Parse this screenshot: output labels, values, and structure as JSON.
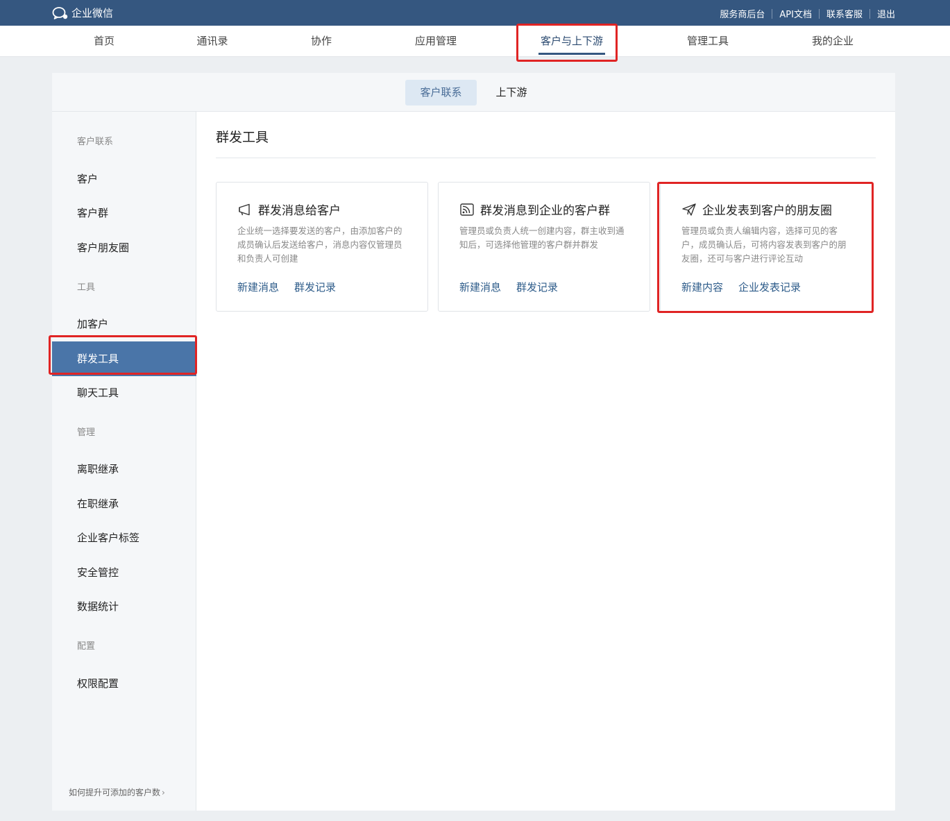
{
  "app": {
    "name": "企业微信"
  },
  "topbar": {
    "links": [
      "服务商后台",
      "API文档",
      "联系客服",
      "退出"
    ]
  },
  "main_nav": {
    "items": [
      "首页",
      "通讯录",
      "协作",
      "应用管理",
      "客户与上下游",
      "管理工具",
      "我的企业"
    ],
    "active": "客户与上下游"
  },
  "sub_nav": {
    "tabs": [
      "客户联系",
      "上下游"
    ],
    "active": "客户联系"
  },
  "sidebar": {
    "groups": [
      {
        "title": "客户联系",
        "items": [
          "客户",
          "客户群",
          "客户朋友圈"
        ]
      },
      {
        "title": "工具",
        "items": [
          "加客户",
          "群发工具",
          "聊天工具"
        ]
      },
      {
        "title": "管理",
        "items": [
          "离职继承",
          "在职继承",
          "企业客户标签",
          "安全管控",
          "数据统计"
        ]
      },
      {
        "title": "配置",
        "items": [
          "权限配置"
        ]
      }
    ],
    "active": "群发工具",
    "footer_link": "如何提升可添加的客户数"
  },
  "content": {
    "title": "群发工具",
    "cards": [
      {
        "icon": "megaphone-icon",
        "title": "群发消息给客户",
        "description": "企业统一选择要发送的客户，由添加客户的成员确认后发送给客户，消息内容仅管理员和负责人可创建",
        "actions": [
          "新建消息",
          "群发记录"
        ]
      },
      {
        "icon": "broadcast-icon",
        "title": "群发消息到企业的客户群",
        "description": "管理员或负责人统一创建内容，群主收到通知后，可选择他管理的客户群并群发",
        "actions": [
          "新建消息",
          "群发记录"
        ]
      },
      {
        "icon": "paper-plane-icon",
        "title": "企业发表到客户的朋友圈",
        "description": "管理员或负责人编辑内容，选择可见的客户，成员确认后，可将内容发表到客户的朋友圈，还可与客户进行评论互动",
        "actions": [
          "新建内容",
          "企业发表记录"
        ]
      }
    ]
  },
  "colors": {
    "topbar": "#355780",
    "accent": "#4a75a8",
    "link": "#2e5c8a",
    "highlight": "#e02424"
  }
}
